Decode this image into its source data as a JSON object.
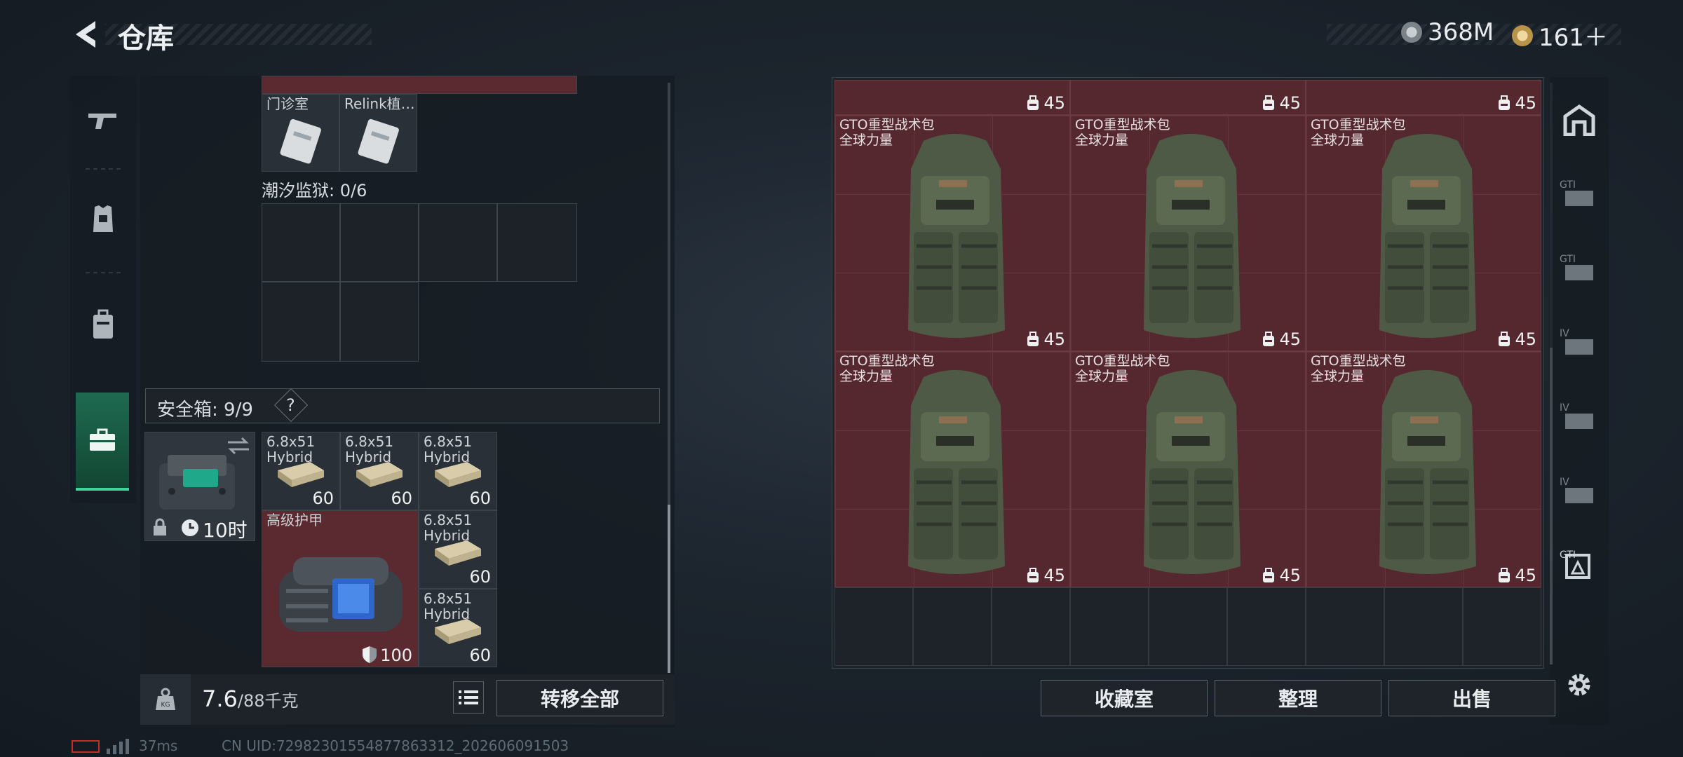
{
  "header": {
    "title": "仓库",
    "currency": "368M",
    "points": "161＋"
  },
  "left_nav": {
    "items": [
      "gun-icon",
      "armor-icon",
      "backpack-icon",
      "safe-case-icon"
    ],
    "active": 3
  },
  "clinic_section": {
    "items": [
      {
        "label": "门诊室",
        "icon": "keycard-icon"
      },
      {
        "label": "Relink植…",
        "icon": "keycard-icon"
      }
    ]
  },
  "tide_prison": {
    "label": "潮汐监狱: 0/6"
  },
  "safe_box": {
    "label": "安全箱: 9/9",
    "help": "?",
    "timer": "10时",
    "ammo_label": "6.8x51\nHybrid",
    "ammo_qty": "60",
    "armor_label": "高级护甲",
    "armor_value": "100"
  },
  "footer": {
    "weight": "7.6",
    "weight_max": "/88千克",
    "transfer_all": "转移全部"
  },
  "stash": {
    "backpack_name": "GTO重型战术包\n全球力量",
    "capacity": "45",
    "top_capacity": "45"
  },
  "right_buttons": {
    "collection": "收藏室",
    "sort": "整理",
    "sell": "出售"
  },
  "status_bar": {
    "ping": "37ms",
    "uid": "CN UID:72982301554877863312_202606091503"
  },
  "colors": {
    "item_red": "#55282f",
    "accent_green": "#3fd49a",
    "panel": "#1d2329"
  }
}
